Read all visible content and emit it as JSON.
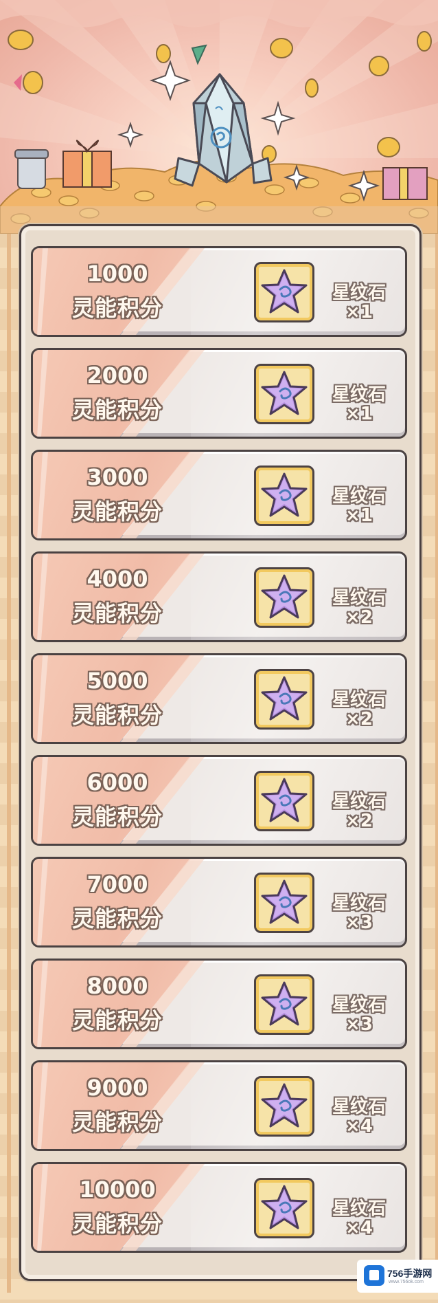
{
  "rewards": [
    {
      "score": "1000",
      "label": "灵能积分",
      "item": "星纹石",
      "qty": "×1"
    },
    {
      "score": "2000",
      "label": "灵能积分",
      "item": "星纹石",
      "qty": "×1"
    },
    {
      "score": "3000",
      "label": "灵能积分",
      "item": "星纹石",
      "qty": "×1"
    },
    {
      "score": "4000",
      "label": "灵能积分",
      "item": "星纹石",
      "qty": "×2"
    },
    {
      "score": "5000",
      "label": "灵能积分",
      "item": "星纹石",
      "qty": "×2"
    },
    {
      "score": "6000",
      "label": "灵能积分",
      "item": "星纹石",
      "qty": "×2"
    },
    {
      "score": "7000",
      "label": "灵能积分",
      "item": "星纹石",
      "qty": "×3"
    },
    {
      "score": "8000",
      "label": "灵能积分",
      "item": "星纹石",
      "qty": "×3"
    },
    {
      "score": "9000",
      "label": "灵能积分",
      "item": "星纹石",
      "qty": "×4"
    },
    {
      "score": "10000",
      "label": "灵能积分",
      "item": "星纹石",
      "qty": "×4"
    }
  ],
  "item_icon": "star-stone-icon",
  "watermark": {
    "text": "756手游网",
    "sub": "www.756ok.com"
  },
  "colors": {
    "banner_pink": "#efb8aa",
    "row_pink": "#f1bca8",
    "item_box_gold": "#f2c95f",
    "star_purple": "#b48ee0",
    "outline": "#4a4242"
  }
}
